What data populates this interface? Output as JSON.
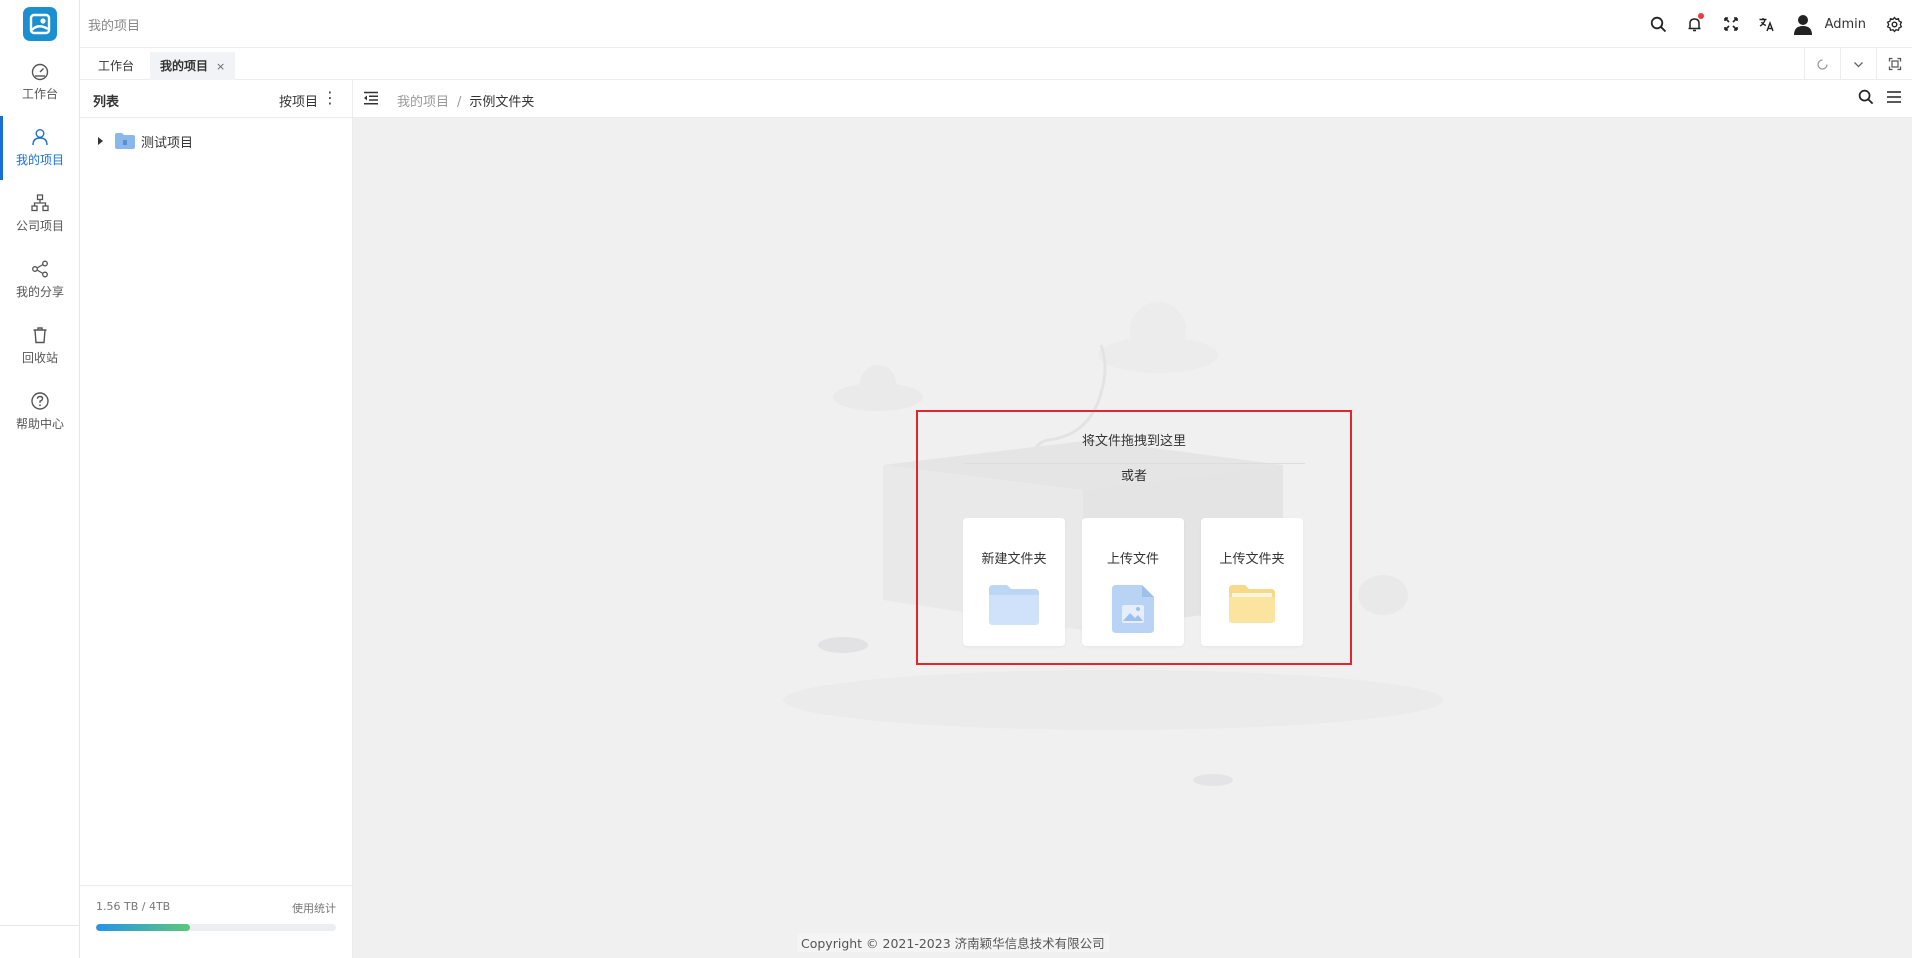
{
  "sidebar": {
    "items": [
      {
        "label": "工作台",
        "icon": "dashboard-icon"
      },
      {
        "label": "我的项目",
        "icon": "user-icon",
        "active": true
      },
      {
        "label": "公司项目",
        "icon": "org-chart-icon"
      },
      {
        "label": "我的分享",
        "icon": "share-icon"
      },
      {
        "label": "回收站",
        "icon": "trash-icon"
      },
      {
        "label": "帮助中心",
        "icon": "help-icon"
      }
    ]
  },
  "header": {
    "title": "我的项目",
    "user_name": "Admin",
    "icons": [
      "search-icon",
      "bell-icon",
      "fullscreen-icon",
      "translate-icon",
      "avatar",
      "gear-icon"
    ]
  },
  "tabs": [
    {
      "label": "工作台"
    },
    {
      "label": "我的项目",
      "active": true,
      "close": "×"
    }
  ],
  "tree": {
    "title": "列表",
    "sort_label": "按项目",
    "more": "⋮",
    "nodes": [
      {
        "label": "测试项目"
      }
    ],
    "storage": {
      "used_label": "1.56 TB / 4TB",
      "stats_label": "使用统计",
      "used_fraction": 0.39
    }
  },
  "main": {
    "breadcrumb": [
      "我的项目",
      "示例文件夹"
    ],
    "separator": "/",
    "drop": {
      "hint": "将文件拖拽到这里",
      "or": "或者",
      "actions": [
        {
          "label": "新建文件夹",
          "icon": "folder-blue-icon"
        },
        {
          "label": "上传文件",
          "icon": "image-file-icon"
        },
        {
          "label": "上传文件夹",
          "icon": "folder-yellow-icon"
        }
      ]
    }
  },
  "footer": {
    "copyright": "Copyright © 2021-2023 济南颖华信息技术有限公司"
  },
  "colors": {
    "accent": "#1a6fd1",
    "logo": "#1a8fd1",
    "highlight_border": "#e0262f",
    "notification": "#f2383f"
  }
}
